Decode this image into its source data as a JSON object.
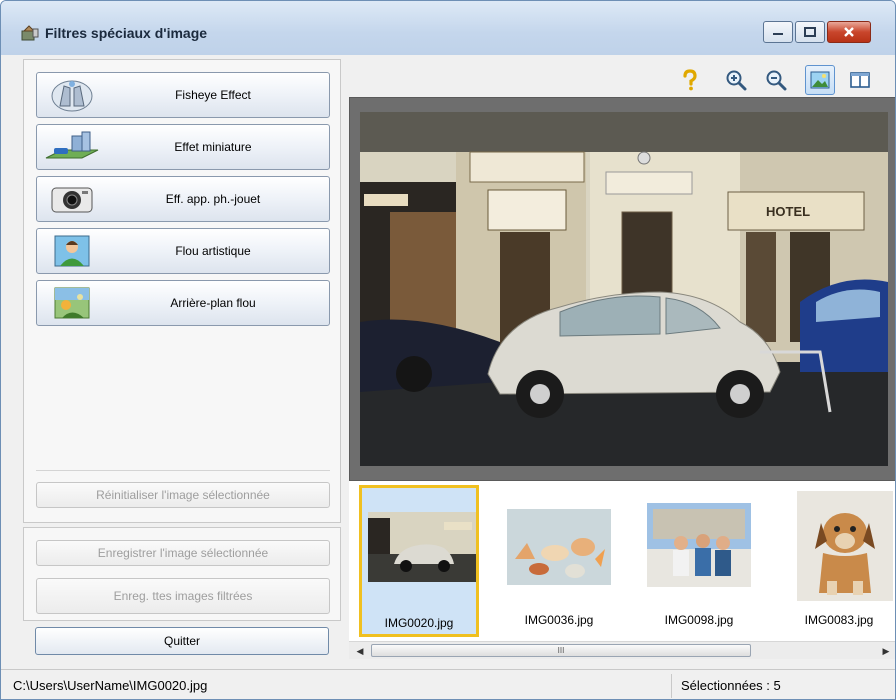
{
  "window": {
    "title": "Filtres spéciaux d'image"
  },
  "effects": [
    {
      "label": "Fisheye Effect",
      "icon": "fisheye-icon"
    },
    {
      "label": "Effet miniature",
      "icon": "miniature-icon"
    },
    {
      "label": "Eff. app. ph.-jouet",
      "icon": "toy-camera-icon"
    },
    {
      "label": "Flou artistique",
      "icon": "portrait-icon"
    },
    {
      "label": "Arrière-plan flou",
      "icon": "landscape-icon"
    }
  ],
  "actions": {
    "reset": "Réinitialiser l'image sélectionnée",
    "save_selected": "Enregistrer l'image sélectionnée",
    "save_all": "Enreg. ttes images filtrées",
    "quit": "Quitter"
  },
  "preview": {
    "hotel_sign": "HOTEL"
  },
  "thumbnails": [
    {
      "name": "IMG0020.jpg",
      "selected": true
    },
    {
      "name": "IMG0036.jpg",
      "selected": false
    },
    {
      "name": "IMG0098.jpg",
      "selected": false
    },
    {
      "name": "IMG0083.jpg",
      "selected": false
    }
  ],
  "scrollbar": {
    "grip": "III"
  },
  "status": {
    "path": "C:\\Users\\UserName\\IMG0020.jpg",
    "selected": "Sélectionnées : 5"
  },
  "colors": {
    "accent": "#f0c020",
    "selection": "#cfe3f6"
  }
}
